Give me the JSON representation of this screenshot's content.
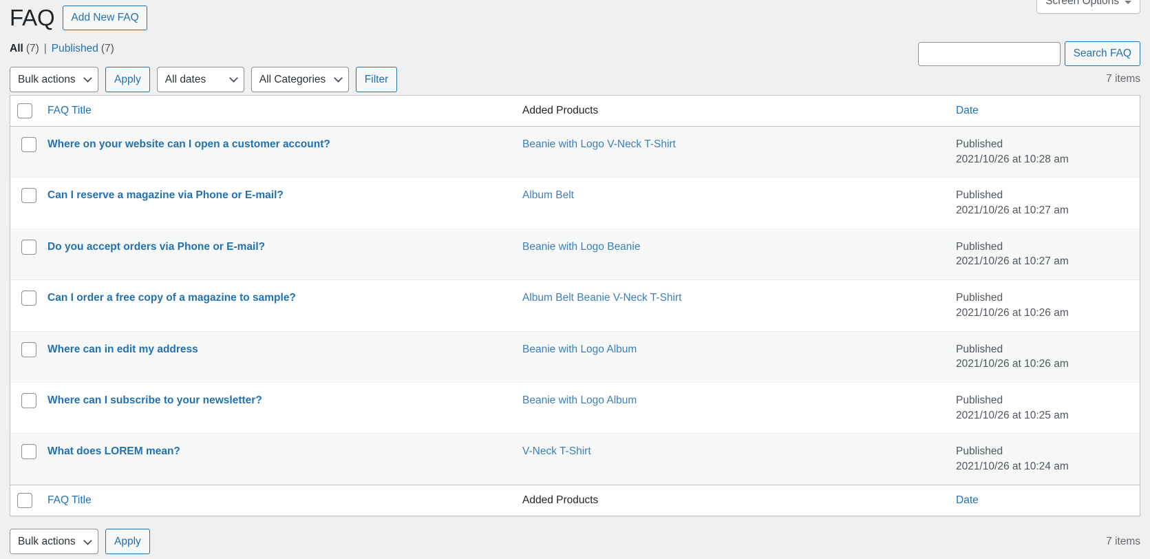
{
  "screen_options": {
    "label": "Screen Options"
  },
  "header": {
    "title": "FAQ",
    "add_new_label": "Add New FAQ"
  },
  "views": {
    "all": {
      "label": "All",
      "count": "(7)"
    },
    "separator": "|",
    "published": {
      "label": "Published",
      "count": "(7)"
    }
  },
  "search": {
    "value": "",
    "placeholder": "",
    "button_label": "Search FAQ"
  },
  "tablenav_top": {
    "bulk_actions_value": "Bulk actions",
    "apply_label": "Apply",
    "dates_value": "All dates",
    "categories_value": "All Categories",
    "filter_label": "Filter",
    "displaying_num": "7 items"
  },
  "tablenav_bottom": {
    "bulk_actions_value": "Bulk actions",
    "apply_label": "Apply",
    "displaying_num": "7 items"
  },
  "table": {
    "columns": {
      "title": "FAQ Title",
      "products": "Added Products",
      "date": "Date"
    },
    "rows": [
      {
        "title": "Where on your website can I open a customer account?",
        "products": "Beanie with Logo V-Neck T-Shirt",
        "status": "Published",
        "timestamp": "2021/10/26 at 10:28 am"
      },
      {
        "title": "Can I reserve a magazine via Phone or E-mail?",
        "products": "Album Belt",
        "status": "Published",
        "timestamp": "2021/10/26 at 10:27 am"
      },
      {
        "title": "Do you accept orders via Phone or E-mail?",
        "products": "Beanie with Logo Beanie",
        "status": "Published",
        "timestamp": "2021/10/26 at 10:27 am"
      },
      {
        "title": "Can I order a free copy of a magazine to sample?",
        "products": "Album Belt Beanie V-Neck T-Shirt",
        "status": "Published",
        "timestamp": "2021/10/26 at 10:26 am"
      },
      {
        "title": "Where can in edit my address",
        "products": "Beanie with Logo Album",
        "status": "Published",
        "timestamp": "2021/10/26 at 10:26 am"
      },
      {
        "title": "Where can I subscribe to your newsletter?",
        "products": "Beanie with Logo Album",
        "status": "Published",
        "timestamp": "2021/10/26 at 10:25 am"
      },
      {
        "title": "What does LOREM mean?",
        "products": "V-Neck T-Shirt",
        "status": "Published",
        "timestamp": "2021/10/26 at 10:24 am"
      }
    ]
  },
  "colors": {
    "link": "#2271b1",
    "product_link": "#3c7fb9",
    "page_bg": "#f0f0f1",
    "row_alt_bg": "#f6f7f7"
  }
}
